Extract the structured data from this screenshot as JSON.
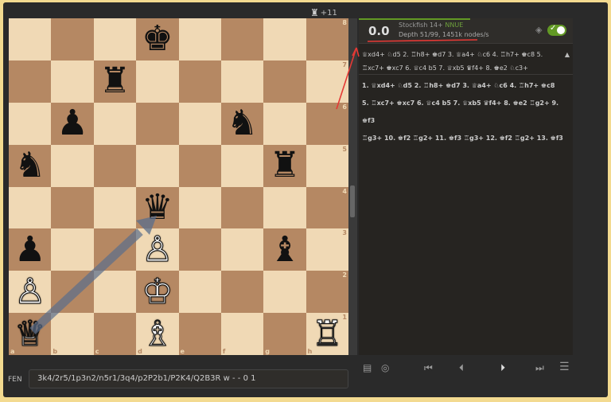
{
  "material": {
    "piece": "♜",
    "diff": "+11"
  },
  "board": {
    "ranks": [
      "8",
      "7",
      "6",
      "5",
      "4",
      "3",
      "2",
      "1"
    ],
    "files": [
      "a",
      "b",
      "c",
      "d",
      "e",
      "f",
      "g",
      "h"
    ],
    "pieces": [
      {
        "sq": "d8",
        "glyph": "♚",
        "color": "b",
        "name": "black-king"
      },
      {
        "sq": "c7",
        "glyph": "♜",
        "color": "b",
        "name": "black-rook"
      },
      {
        "sq": "b6",
        "glyph": "♟",
        "color": "b",
        "name": "black-pawn"
      },
      {
        "sq": "f6",
        "glyph": "♞",
        "color": "b",
        "name": "black-knight"
      },
      {
        "sq": "a5",
        "glyph": "♞",
        "color": "b",
        "name": "black-knight"
      },
      {
        "sq": "g5",
        "glyph": "♜",
        "color": "b",
        "name": "black-rook"
      },
      {
        "sq": "d4",
        "glyph": "♛",
        "color": "b",
        "name": "black-queen"
      },
      {
        "sq": "a3",
        "glyph": "♟",
        "color": "b",
        "name": "black-pawn"
      },
      {
        "sq": "d3",
        "glyph": "♙",
        "color": "w",
        "name": "white-pawn"
      },
      {
        "sq": "g3",
        "glyph": "♝",
        "color": "b",
        "name": "black-bishop"
      },
      {
        "sq": "a2",
        "glyph": "♙",
        "color": "w",
        "name": "white-pawn"
      },
      {
        "sq": "d2",
        "glyph": "♔",
        "color": "w",
        "name": "white-king"
      },
      {
        "sq": "a1",
        "glyph": "♕",
        "color": "w",
        "name": "white-queen"
      },
      {
        "sq": "d1",
        "glyph": "♗",
        "color": "w",
        "name": "white-bishop"
      },
      {
        "sq": "h1",
        "glyph": "♖",
        "color": "w",
        "name": "white-rook"
      }
    ]
  },
  "engine": {
    "score": "0.0",
    "name": "Stockfish 14+",
    "nnue": "NNUE",
    "depth": "Depth 51/99, 1451k nodes/s"
  },
  "pv": {
    "eval": "",
    "line": "♕xd4+ ♘d5 2. ♖h8+ ♚d7 3. ♕a4+ ♘c6 4. ♖h7+ ♚c8 5. ♖xc7+ ♚xc7 6. ♕c4 b5 7. ♕xb5 ♛f4+ 8. ♚e2 ♘c3+"
  },
  "moves": [
    "1. ♕xd4+ ♘d5 2. ♖h8+ ♚d7 3. ♕a4+ ♘c6 4. ♖h7+ ♚c8",
    "5. ♖xc7+ ♚xc7 6. ♕c4 b5 7. ♕xb5 ♛f4+ 8. ♚e2 ♖g2+ 9. ♚f3",
    "♖g3+ 10. ♚f2 ♖g2+ 11. ♚f3 ♖g3+ 12. ♚f2 ♖g2+ 13. ♚f3"
  ],
  "controls": {
    "book": "▤",
    "target": "◎",
    "first": "⏮",
    "prev": "⏴",
    "next": "⏵",
    "last": "⏭",
    "menu": "☰"
  },
  "fen": {
    "label": "FEN",
    "value": "3k4/2r5/1p3n2/n5r1/3q4/p2P2b1/P2K4/Q2B3R w - - 0 1"
  },
  "colors": {
    "light": "#f0d9b5",
    "dark": "#b58863",
    "accent": "#629924",
    "annotation": "#e53935"
  }
}
